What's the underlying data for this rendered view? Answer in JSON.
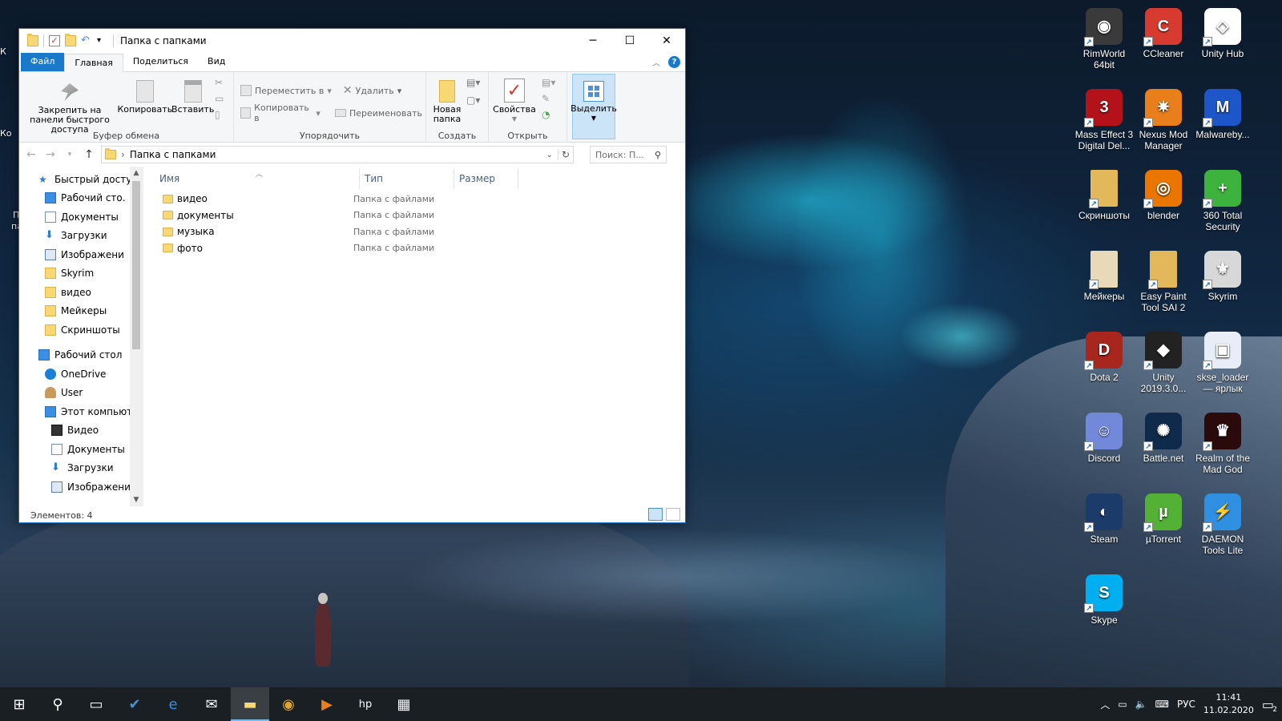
{
  "desktop": {
    "left_edge": [
      "К",
      "Ко",
      "П",
      "па"
    ],
    "icons": [
      {
        "label": "RimWorld 64bit",
        "icon": "rimworld-icon",
        "color": "#3a3a3a",
        "glyph": "◉"
      },
      {
        "label": "CCleaner",
        "icon": "ccleaner-icon",
        "color": "#d73b2f",
        "glyph": "C"
      },
      {
        "label": "Unity Hub",
        "icon": "unity-hub-icon",
        "color": "#ffffff",
        "glyph": "◇"
      },
      {
        "label": "Mass Effect 3 Digital Del...",
        "icon": "mass-effect-icon",
        "color": "#b3121a",
        "glyph": "3"
      },
      {
        "label": "Nexus Mod Manager",
        "icon": "nexus-icon",
        "color": "#e87f1a",
        "glyph": "✷"
      },
      {
        "label": "Malwareby...",
        "icon": "malwarebytes-icon",
        "color": "#1d56c9",
        "glyph": "M"
      },
      {
        "label": "Скриншоты",
        "icon": "folder-icon",
        "color": "#e3b85a",
        "glyph": ""
      },
      {
        "label": "blender",
        "icon": "blender-icon",
        "color": "#ea7600",
        "glyph": "◎"
      },
      {
        "label": "360 Total Security",
        "icon": "360-security-icon",
        "color": "#3db33d",
        "glyph": "+"
      },
      {
        "label": "Мейкеры",
        "icon": "folder-icon",
        "color": "#e8d9b8",
        "glyph": ""
      },
      {
        "label": "Easy Paint Tool SAI 2",
        "icon": "folder-icon",
        "color": "#e3b85a",
        "glyph": ""
      },
      {
        "label": "Skyrim",
        "icon": "skyrim-icon",
        "color": "#d8d8d8",
        "glyph": "⚜"
      },
      {
        "label": "Dota 2",
        "icon": "dota-icon",
        "color": "#a7261d",
        "glyph": "D"
      },
      {
        "label": "Unity 2019.3.0...",
        "icon": "unity-icon",
        "color": "#222222",
        "glyph": "◆"
      },
      {
        "label": "skse_loader — ярлык",
        "icon": "skse-icon",
        "color": "#e8eef8",
        "glyph": "▣"
      },
      {
        "label": "Discord",
        "icon": "discord-icon",
        "color": "#7289da",
        "glyph": "☺"
      },
      {
        "label": "Battle.net",
        "icon": "battlenet-icon",
        "color": "#0f2a4a",
        "glyph": "✺"
      },
      {
        "label": "Realm of the Mad God",
        "icon": "rotmg-icon",
        "color": "#2a0a0a",
        "glyph": "♛"
      },
      {
        "label": "Steam",
        "icon": "steam-icon",
        "color": "#1b3b6b",
        "glyph": "◐"
      },
      {
        "label": "µTorrent",
        "icon": "utorrent-icon",
        "color": "#53b136",
        "glyph": "µ"
      },
      {
        "label": "DAEMON Tools Lite",
        "icon": "daemon-tools-icon",
        "color": "#2f8fe0",
        "glyph": "⚡"
      },
      {
        "label": "Skype",
        "icon": "skype-icon",
        "color": "#00aff0",
        "glyph": "S"
      }
    ]
  },
  "window": {
    "title": "Папка с папками",
    "controls": {
      "minimize": "─",
      "maximize": "☐",
      "close": "✕"
    },
    "tabs": [
      "Файл",
      "Главная",
      "Поделиться",
      "Вид"
    ],
    "ribbon": {
      "clipboard": {
        "pin": "Закрепить на панели быстрого доступа",
        "copy": "Копировать",
        "paste": "Вставить",
        "label": "Буфер обмена"
      },
      "organize": {
        "move_to": "Переместить в",
        "copy_to": "Копировать в",
        "delete": "Удалить",
        "rename": "Переименовать",
        "label": "Упорядочить"
      },
      "create": {
        "new_folder": "Новая папка",
        "label": "Создать"
      },
      "open": {
        "properties": "Свойства",
        "label": "Открыть"
      },
      "select": {
        "select": "Выделить"
      }
    },
    "address": {
      "path": "Папка с папками",
      "search_placeholder": "Поиск: П..."
    },
    "nav": {
      "quick_access": "Быстрый доступ",
      "quick_items": [
        {
          "label": "Рабочий сто.",
          "icon": "desktop-icon",
          "pinned": true
        },
        {
          "label": "Документы",
          "icon": "documents-icon",
          "pinned": true
        },
        {
          "label": "Загрузки",
          "icon": "downloads-icon",
          "pinned": true
        },
        {
          "label": "Изображени",
          "icon": "pictures-icon",
          "pinned": true
        },
        {
          "label": "Skyrim",
          "icon": "folder-icon",
          "pinned": false
        },
        {
          "label": "видео",
          "icon": "folder-icon",
          "pinned": false
        },
        {
          "label": "Мейкеры",
          "icon": "folder-icon",
          "pinned": false
        },
        {
          "label": "Скриншоты",
          "icon": "folder-icon",
          "pinned": false
        }
      ],
      "desktop": "Рабочий стол",
      "desktop_items": [
        {
          "label": "OneDrive",
          "icon": "onedrive-icon",
          "indent": 1
        },
        {
          "label": "User",
          "icon": "user-icon",
          "indent": 1
        },
        {
          "label": "Этот компьютер",
          "icon": "computer-icon",
          "indent": 1
        },
        {
          "label": "Видео",
          "icon": "video-icon",
          "indent": 2
        },
        {
          "label": "Документы",
          "icon": "documents-icon",
          "indent": 2
        },
        {
          "label": "Загрузки",
          "icon": "downloads-icon",
          "indent": 2
        },
        {
          "label": "Изображения",
          "icon": "pictures-icon",
          "indent": 2
        }
      ]
    },
    "columns": {
      "name": "Имя",
      "type": "Тип",
      "size": "Размер"
    },
    "files": [
      {
        "name": "видео",
        "type": "Папка с файлами"
      },
      {
        "name": "документы",
        "type": "Папка с файлами"
      },
      {
        "name": "музыка",
        "type": "Папка с файлами"
      },
      {
        "name": "фото",
        "type": "Папка с файлами"
      }
    ],
    "status": "Элементов: 4"
  },
  "taskbar": {
    "apps": [
      {
        "icon": "start-icon",
        "glyph": "⊞"
      },
      {
        "icon": "search-icon",
        "glyph": "⚲"
      },
      {
        "icon": "task-view-icon",
        "glyph": "▭"
      },
      {
        "icon": "mail-app-icon",
        "glyph": "✔"
      },
      {
        "icon": "edge-icon",
        "glyph": "e"
      },
      {
        "icon": "mail-icon",
        "glyph": "✉"
      },
      {
        "icon": "file-explorer-icon",
        "glyph": "▬"
      },
      {
        "icon": "chrome-icon",
        "glyph": "◉"
      },
      {
        "icon": "media-player-icon",
        "glyph": "▶"
      },
      {
        "icon": "hp-icon",
        "glyph": "hp"
      },
      {
        "icon": "store-icon",
        "glyph": "▦"
      }
    ],
    "language": "РУС",
    "time": "11:41",
    "date": "11.02.2020",
    "notifications": "2"
  }
}
